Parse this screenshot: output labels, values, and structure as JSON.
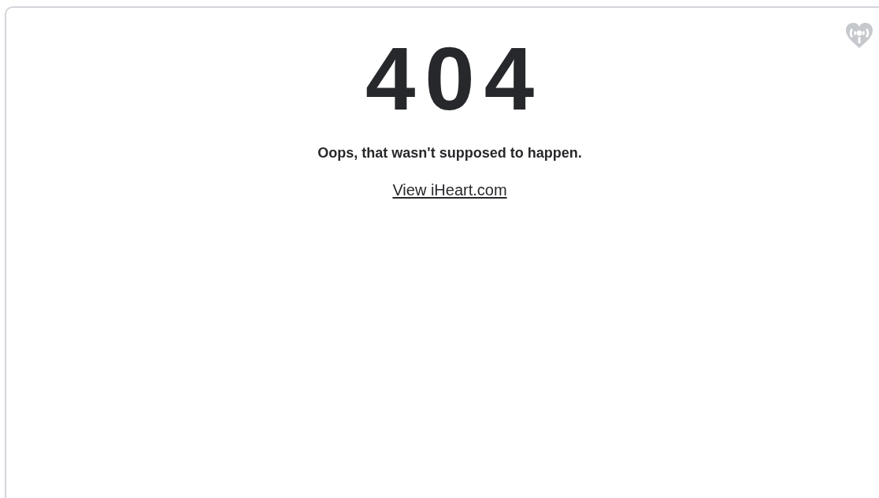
{
  "error_code": "404",
  "message": "Oops, that wasn't supposed to happen.",
  "link": {
    "label": "View iHeart.com"
  }
}
